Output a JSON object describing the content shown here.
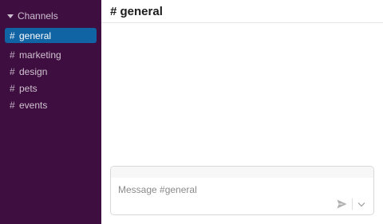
{
  "sidebar": {
    "section_label": "Channels",
    "channels": [
      {
        "hash": "#",
        "name": "general",
        "active": true
      },
      {
        "hash": "#",
        "name": "marketing",
        "active": false
      },
      {
        "hash": "#",
        "name": "design",
        "active": false
      },
      {
        "hash": "#",
        "name": "pets",
        "active": false
      },
      {
        "hash": "#",
        "name": "events",
        "active": false
      }
    ]
  },
  "header": {
    "title": "# general"
  },
  "composer": {
    "placeholder": "Message #general",
    "value": "",
    "send_icon": "send-icon",
    "options_icon": "chevron-down-icon"
  },
  "colors": {
    "sidebar_bg": "#3f0e40",
    "active_channel_bg": "#1164a3",
    "sidebar_text": "#cfc3d0"
  }
}
